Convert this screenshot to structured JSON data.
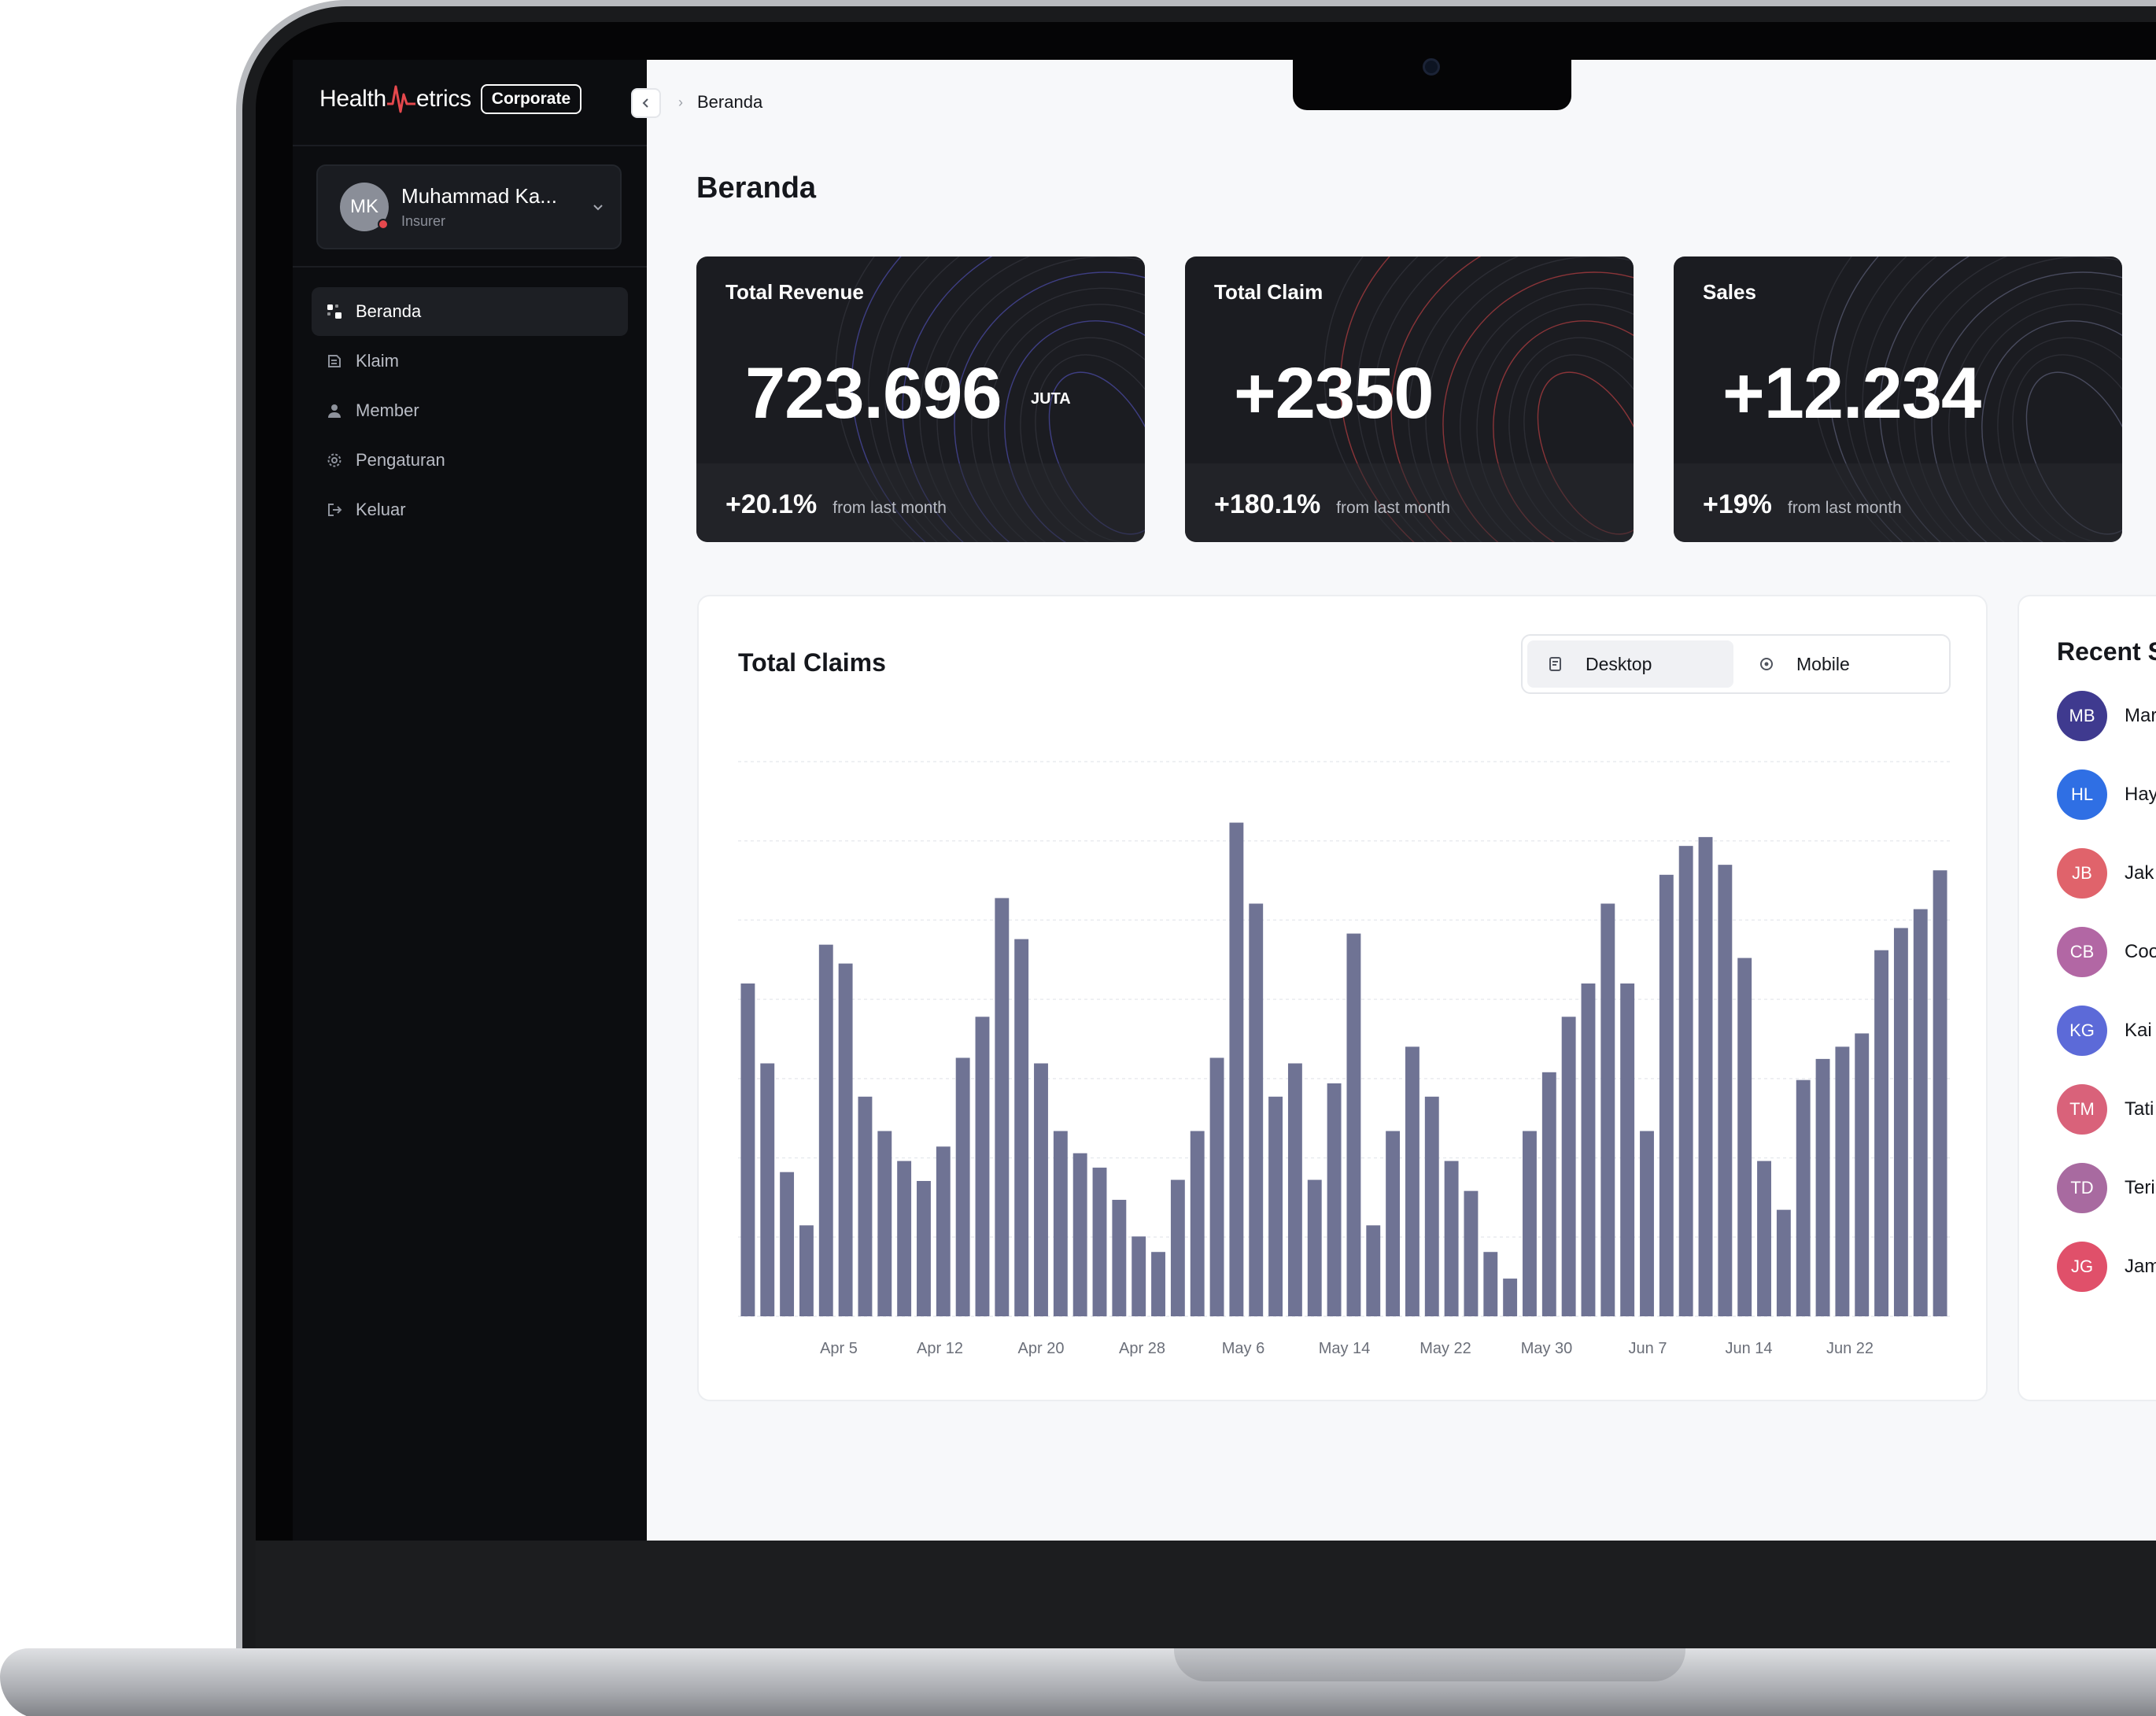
{
  "brand": {
    "name_left": "Health",
    "name_right": "etrics",
    "badge": "Corporate"
  },
  "user": {
    "initials": "MK",
    "name": "Muhammad Ka...",
    "role": "Insurer"
  },
  "nav": [
    {
      "label": "Beranda",
      "icon": "grid-icon",
      "active": true
    },
    {
      "label": "Klaim",
      "icon": "claim-icon",
      "active": false
    },
    {
      "label": "Member",
      "icon": "user-icon",
      "active": false
    },
    {
      "label": "Pengaturan",
      "icon": "gear-icon",
      "active": false
    },
    {
      "label": "Keluar",
      "icon": "logout-icon",
      "active": false
    }
  ],
  "breadcrumb": {
    "current": "Beranda"
  },
  "page": {
    "title": "Beranda"
  },
  "stats": [
    {
      "title": "Total Revenue",
      "value": "723.696",
      "unit": "JUTA",
      "change": "+20.1%",
      "change_note": "from last month",
      "accent": "#5b5bd6"
    },
    {
      "title": "Total Claim",
      "value": "+2350",
      "unit": "",
      "change": "+180.1%",
      "change_note": "from last month",
      "accent": "#e5484d"
    },
    {
      "title": "Sales",
      "value": "+12.234",
      "unit": "",
      "change": "+19%",
      "change_note": "from last month",
      "accent": "#6e7190"
    }
  ],
  "chart_card": {
    "title": "Total Claims",
    "toggle": {
      "options": [
        "Desktop",
        "Mobile"
      ],
      "selected": "Desktop"
    }
  },
  "chart_data": {
    "type": "bar",
    "title": "Total Claims",
    "bar_color": "#6f7394",
    "xtick_labels": [
      "Apr 5",
      "Apr 12",
      "Apr 20",
      "Apr 28",
      "May 6",
      "May 14",
      "May 22",
      "May 30",
      "Jun 7",
      "Jun 14",
      "Jun 22"
    ],
    "ylim": [
      0,
      500
    ],
    "grid": true,
    "values": [
      300,
      228,
      130,
      82,
      335,
      318,
      198,
      167,
      140,
      122,
      153,
      233,
      270,
      377,
      340,
      228,
      167,
      147,
      134,
      105,
      72,
      58,
      123,
      167,
      233,
      445,
      372,
      198,
      228,
      123,
      210,
      345,
      82,
      167,
      243,
      198,
      140,
      113,
      58,
      34,
      167,
      220,
      270,
      300,
      372,
      300,
      167,
      398,
      424,
      432,
      407,
      323,
      140,
      96,
      213,
      232,
      243,
      255,
      330,
      350,
      367,
      402
    ]
  },
  "recent_sales": {
    "title": "Recent Sales",
    "items": [
      {
        "initials": "MB",
        "name": "Mar",
        "color": "#3f3a8f"
      },
      {
        "initials": "HL",
        "name": "Hay",
        "color": "#2f6fe4"
      },
      {
        "initials": "JB",
        "name": "Jak",
        "color": "#e0636b"
      },
      {
        "initials": "CB",
        "name": "Coo",
        "color": "#b267a4"
      },
      {
        "initials": "KG",
        "name": "Kai",
        "color": "#5c6ad8"
      },
      {
        "initials": "TM",
        "name": "Tati",
        "color": "#d9627a"
      },
      {
        "initials": "TD",
        "name": "Teri",
        "color": "#a86aa0"
      },
      {
        "initials": "JG",
        "name": "Jam",
        "color": "#e0506a"
      }
    ]
  }
}
